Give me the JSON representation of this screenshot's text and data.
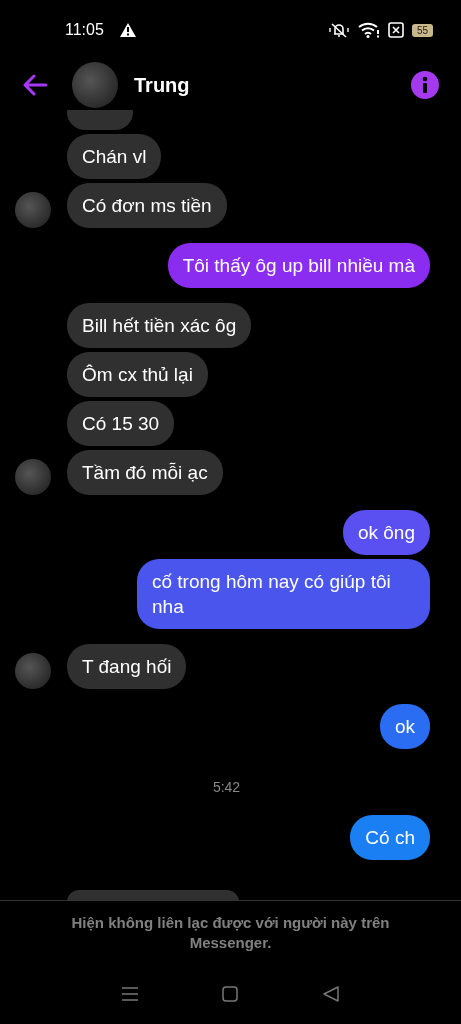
{
  "status_bar": {
    "time": "11:05",
    "battery": "55"
  },
  "header": {
    "contact_name": "Trung"
  },
  "messages": [
    {
      "kind": "partial_in"
    },
    {
      "kind": "in",
      "text": "Chán vl",
      "avatar": false
    },
    {
      "kind": "in",
      "text": "Có đơn ms tiền",
      "avatar": true
    },
    {
      "kind": "out",
      "text": "Tôi thấy ôg up bill nhiều mà",
      "color": "#8b2df0"
    },
    {
      "kind": "in",
      "text": "Bill hết tiền xác ôg",
      "avatar": false
    },
    {
      "kind": "in",
      "text": "Ôm cx thủ lại",
      "avatar": false
    },
    {
      "kind": "in",
      "text": "Có 15 30",
      "avatar": false
    },
    {
      "kind": "in",
      "text": "Tầm đó mỗi ạc",
      "avatar": true
    },
    {
      "kind": "out",
      "text": "ok ông",
      "color": "#5a4ff0"
    },
    {
      "kind": "out",
      "text": "cố trong hôm nay có giúp tôi nha",
      "color": "#4a55ee"
    },
    {
      "kind": "in",
      "text": "T đang hối",
      "avatar": true
    },
    {
      "kind": "out",
      "text": "ok",
      "color": "#2a6cf2"
    },
    {
      "kind": "time",
      "text": "5:42"
    },
    {
      "kind": "out",
      "text": "Có ch",
      "color": "#1a7ff2"
    },
    {
      "kind": "partial_in"
    }
  ],
  "footer": {
    "notice": "Hiện không liên lạc được với người này trên Messenger."
  }
}
